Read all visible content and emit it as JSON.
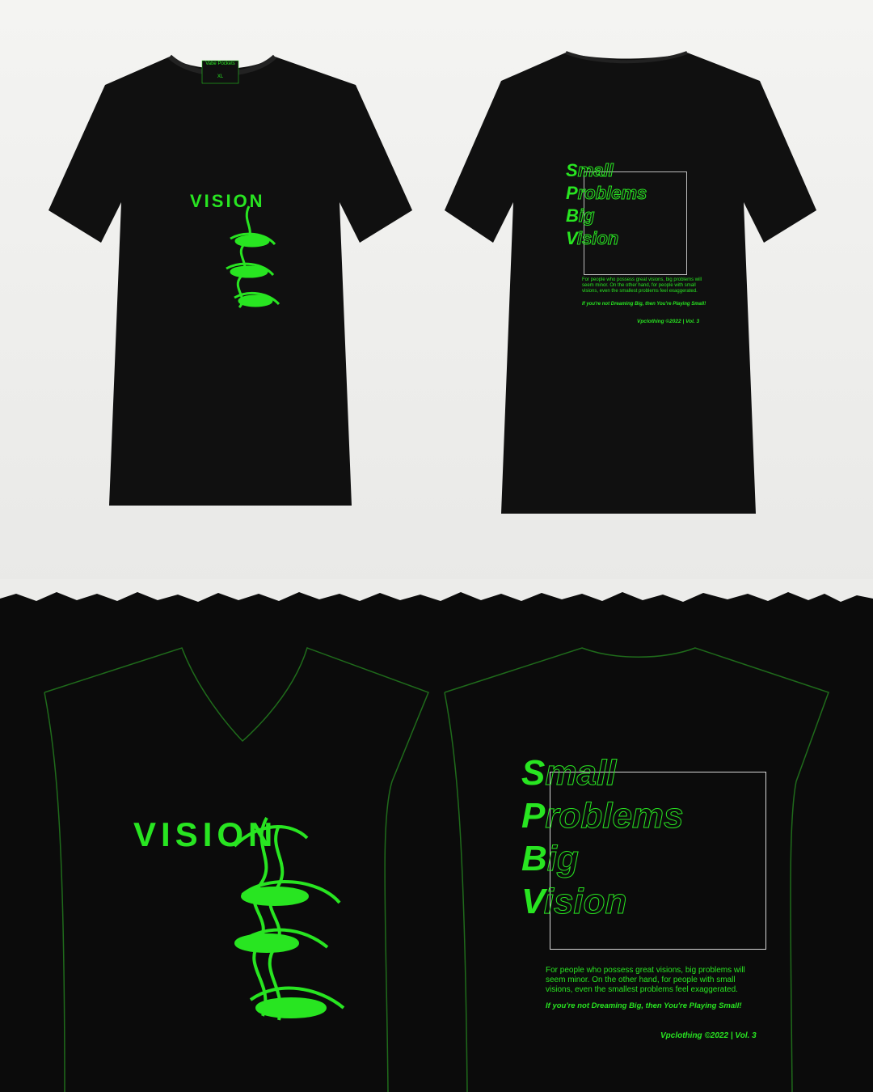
{
  "front": {
    "label_brand": "Vabe Pockets",
    "label_size": "XL",
    "vision_word": "VISION"
  },
  "back": {
    "lines": [
      {
        "initial": "S",
        "rest": "mall"
      },
      {
        "initial": "P",
        "rest": "roblems"
      },
      {
        "initial": "B",
        "rest": "ig"
      },
      {
        "initial": "V",
        "rest": "ision"
      }
    ],
    "paragraph": "For people who possess great visions, big problems will seem minor. On the other hand, for people with small visions, even the smallest problems feel exaggerated.",
    "tagline": "If you're not Dreaming Big, then You're Playing Small!",
    "credit": "Vpclothing ©2022 | Vol. 3"
  },
  "colors": {
    "accent": "#28e521",
    "shirt": "#0f0f0f",
    "background": "#ececea",
    "frame": "#d6d6d6"
  }
}
